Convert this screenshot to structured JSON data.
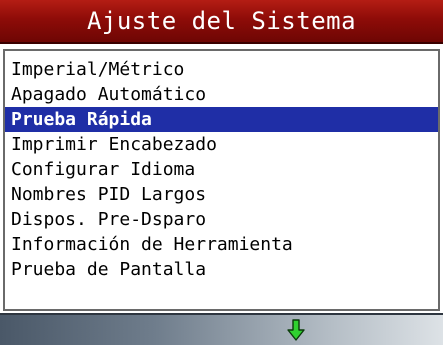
{
  "title": "Ajuste del Sistema",
  "menu": {
    "items": [
      {
        "label": "Imperial/Métrico",
        "selected": false
      },
      {
        "label": "Apagado Automático",
        "selected": false
      },
      {
        "label": "Prueba Rápida",
        "selected": true
      },
      {
        "label": "Imprimir Encabezado",
        "selected": false
      },
      {
        "label": "Configurar Idioma",
        "selected": false
      },
      {
        "label": "Nombres PID Largos",
        "selected": false
      },
      {
        "label": "Dispos. Pre-Dsparo",
        "selected": false
      },
      {
        "label": "Información de Herramienta",
        "selected": false
      },
      {
        "label": "Prueba de Pantalla",
        "selected": false
      }
    ]
  },
  "status_bar": {
    "scroll_icon": "green-down-arrow-icon",
    "colors": {
      "arrow_fill": "#2fd12f",
      "selection": "#1f2ea6",
      "title_bg": "#8e0c08"
    }
  }
}
